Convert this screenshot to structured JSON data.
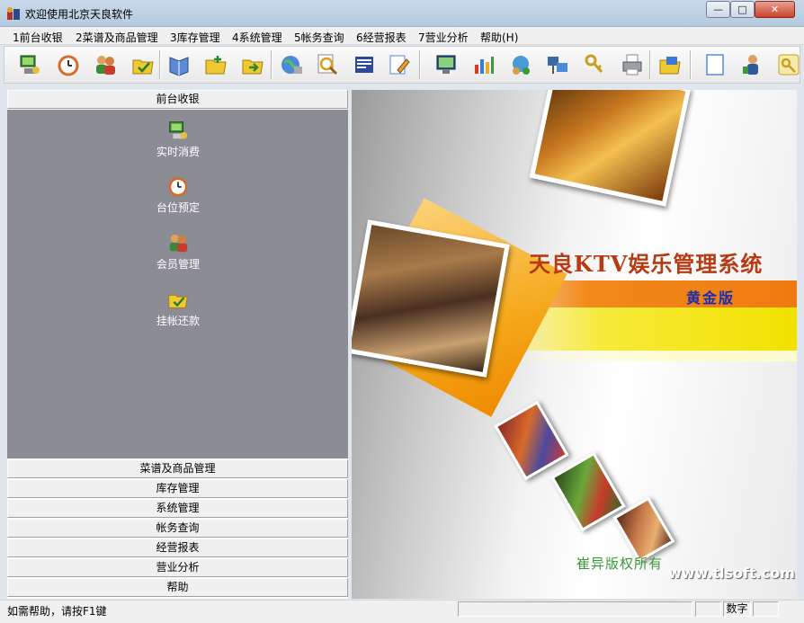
{
  "window": {
    "title": "欢迎使用北京天良软件",
    "minimize_label": "—",
    "maximize_label": "□",
    "close_label": "✕"
  },
  "menu": [
    {
      "label": "1前台收银"
    },
    {
      "label": "2菜谱及商品管理"
    },
    {
      "label": "3库存管理"
    },
    {
      "label": "4系统管理"
    },
    {
      "label": "5帐务查询"
    },
    {
      "label": "6经营报表"
    },
    {
      "label": "7营业分析"
    },
    {
      "label": "帮助(H)"
    }
  ],
  "toolbar_icons": [
    "pos-computer-icon",
    "clock-icon",
    "members-icon",
    "folder-check-icon",
    "book-icon",
    "folder-add-icon",
    "folder-arrow-icon",
    "globe-icon",
    "magnifier-icon",
    "document-icon",
    "notepad-edit-icon",
    "monitor-icon",
    "chart-icon",
    "network-icon",
    "computer-network-icon",
    "keys-icon",
    "printer-icon",
    "folder-settings-icon",
    "blank-page-icon",
    "user-help-icon",
    "key-icon"
  ],
  "sidebar": {
    "active_section": "前台收银",
    "items": [
      {
        "label": "实时消费",
        "icon": "pos-computer-icon"
      },
      {
        "label": "台位预定",
        "icon": "clock-icon"
      },
      {
        "label": "会员管理",
        "icon": "members-icon"
      },
      {
        "label": "挂帐还款",
        "icon": "folder-check-icon"
      }
    ],
    "other_sections": [
      "菜谱及商品管理",
      "库存管理",
      "系统管理",
      "帐务查询",
      "经营报表",
      "营业分析",
      "帮助"
    ]
  },
  "banner": {
    "system_title": "天良KTV娱乐管理系统",
    "edition": "黄金版",
    "copyright": "崔异版权所有",
    "url": "www.tlsoft.com.cn"
  },
  "statusbar": {
    "help_text": "如需帮助，请按F1键",
    "mode": "数字"
  },
  "colors": {
    "sidebar_panel": "#8c8c94",
    "stripe_orange": "#ef7a10",
    "stripe_yellow": "#f2e200",
    "title_red": "#b63a12",
    "edition_blue": "#1a2cb0"
  }
}
